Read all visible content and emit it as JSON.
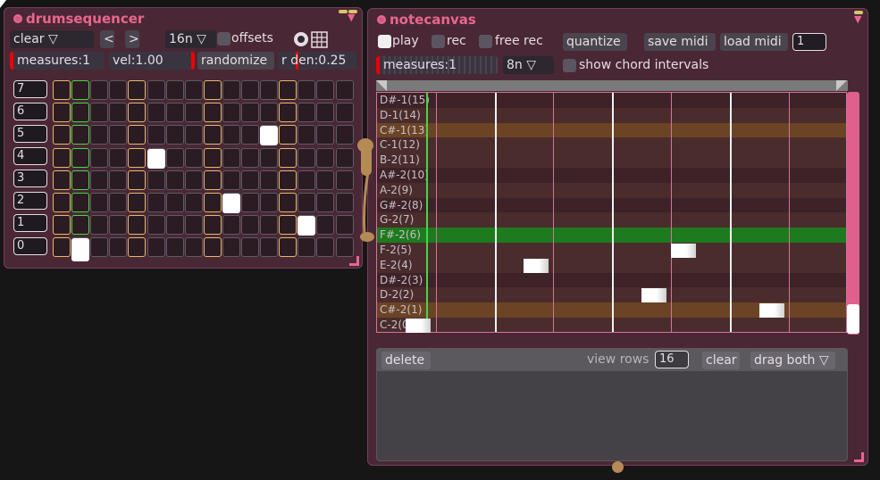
{
  "drumseq": {
    "title": "drumsequencer",
    "clear_select": "clear ▽",
    "prev": "<",
    "next": ">",
    "interval_select": "16n ▽",
    "offsets_label": "offsets",
    "measures": "measures:1",
    "velocity": "vel:1.00",
    "randomize": "randomize",
    "rden": "r den:0.25",
    "rows": [
      "7",
      "6",
      "5",
      "4",
      "3",
      "2",
      "1",
      "0"
    ]
  },
  "notecanvas": {
    "title": "notecanvas",
    "play_label": "play",
    "rec_label": "rec",
    "freerec_label": "free rec",
    "quantize": "quantize",
    "save_midi": "save midi",
    "load_midi": "load midi",
    "track_value": "1",
    "measures": "measures:1",
    "interval_select": "8n ▽",
    "show_chord_label": "show chord intervals",
    "delete_button": "delete",
    "view_rows_label": "view rows",
    "view_rows_value": "16",
    "clear_button": "clear",
    "drag_select": "drag both ▽",
    "pitch_rows": [
      "D#-1(15)",
      "D-1(14)",
      "C#-1(13)",
      "C-1(12)",
      "B-2(11)",
      "A#-2(10)",
      "A-2(9)",
      "G#-2(8)",
      "G-2(7)",
      "F#-2(6)",
      "F-2(5)",
      "E-2(4)",
      "D#-2(3)",
      "D-2(2)",
      "C#-2(1)",
      "C-2(0)"
    ]
  },
  "colors": {
    "accent": "#e8678f",
    "panel": "#4a2735",
    "beat_marker": "#e5b96b",
    "playhead": "#46d646",
    "highlight_row": "#1e7a1e",
    "cable": "#b58a55"
  },
  "icons": {
    "power": "power-dot-icon",
    "collapse": "triangle-down-icon",
    "resize": "resize-corner-icon",
    "grid": "grid-icon",
    "circle": "circle-toggle-icon"
  }
}
